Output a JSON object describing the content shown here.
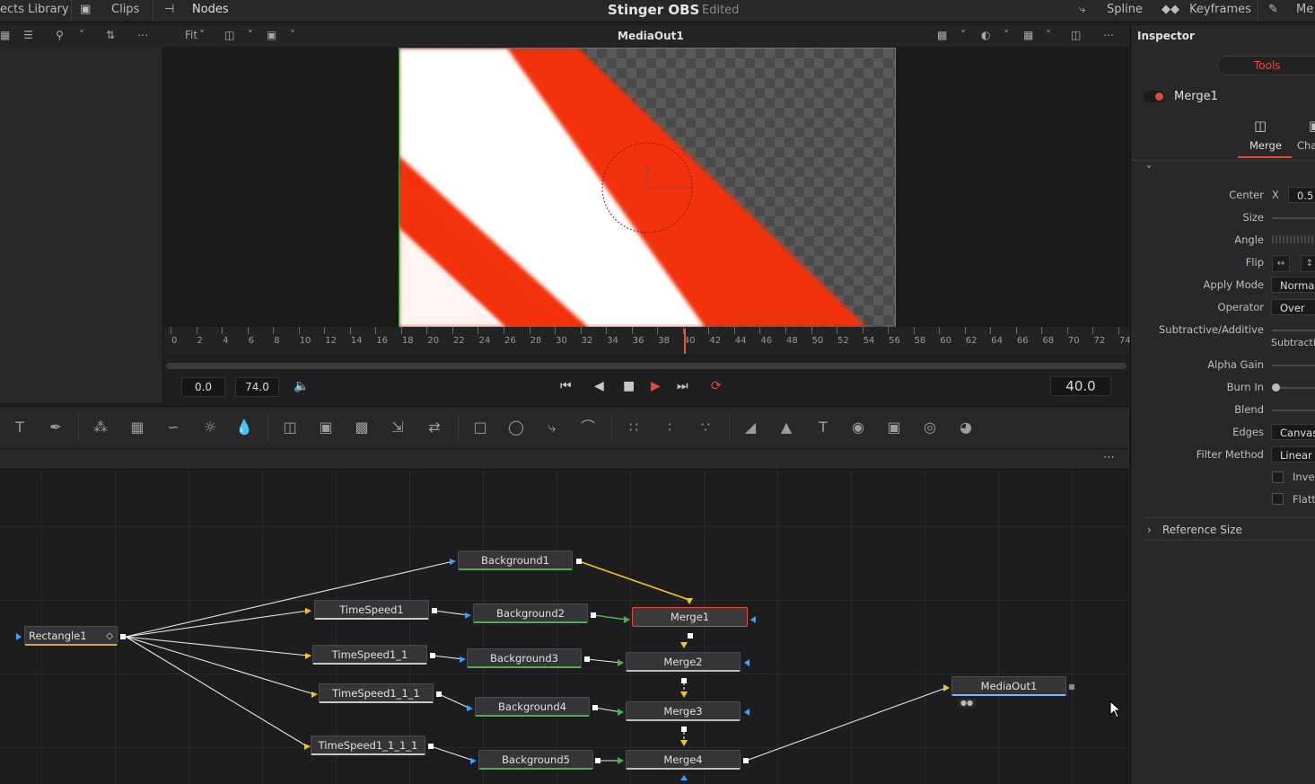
{
  "topbar": {
    "effects_library": "ects Library",
    "clips": "Clips",
    "nodes": "Nodes",
    "title": "Stinger OBS",
    "status": "Edited",
    "spline": "Spline",
    "keyframes": "Keyframes",
    "metadata": "Me"
  },
  "viewer": {
    "zoom": "Fit",
    "title": "MediaOut1"
  },
  "ruler": {
    "ticks": [
      "0",
      "2",
      "4",
      "6",
      "8",
      "10",
      "12",
      "14",
      "16",
      "18",
      "20",
      "22",
      "24",
      "26",
      "28",
      "30",
      "32",
      "34",
      "36",
      "38",
      "40",
      "42",
      "44",
      "46",
      "48",
      "50",
      "52",
      "54",
      "56",
      "58",
      "60",
      "62",
      "64",
      "66",
      "68",
      "70",
      "72",
      "74"
    ]
  },
  "transport": {
    "start": "0.0",
    "end": "74.0",
    "current": "40.0"
  },
  "nodes": [
    {
      "id": "rect",
      "label": "Rectangle1"
    },
    {
      "id": "bg1",
      "label": "Background1"
    },
    {
      "id": "ts1",
      "label": "TimeSpeed1"
    },
    {
      "id": "bg2",
      "label": "Background2"
    },
    {
      "id": "m1",
      "label": "Merge1"
    },
    {
      "id": "ts2",
      "label": "TimeSpeed1_1"
    },
    {
      "id": "bg3",
      "label": "Background3"
    },
    {
      "id": "m2",
      "label": "Merge2"
    },
    {
      "id": "ts3",
      "label": "TimeSpeed1_1_1"
    },
    {
      "id": "bg4",
      "label": "Background4"
    },
    {
      "id": "m3",
      "label": "Merge3"
    },
    {
      "id": "ts4",
      "label": "TimeSpeed1_1_1_1"
    },
    {
      "id": "bg5",
      "label": "Background5"
    },
    {
      "id": "m4",
      "label": "Merge4"
    },
    {
      "id": "out",
      "label": "MediaOut1"
    }
  ],
  "inspector": {
    "title": "Inspector",
    "tools_tab": "Tools",
    "node_name": "Merge1",
    "merge_tab": "Merge",
    "channels_tab": "Cha",
    "center_label": "Center",
    "center_x_label": "X",
    "center_x_value": "0.5",
    "size_label": "Size",
    "angle_label": "Angle",
    "flip_label": "Flip",
    "apply_mode_label": "Apply Mode",
    "apply_mode_value": "Normal",
    "operator_label": "Operator",
    "operator_value": "Over",
    "sub_add_label": "Subtractive/Additive",
    "sub_add_value": "Subtractiv",
    "alpha_gain_label": "Alpha Gain",
    "burn_in_label": "Burn In",
    "blend_label": "Blend",
    "edges_label": "Edges",
    "edges_value": "Canvas",
    "filter_label": "Filter Method",
    "filter_value": "Linear",
    "invert_label": "Inver",
    "flatten_label": "Flatte",
    "reference_size": "Reference Size"
  },
  "colors": {
    "accent_red": "#e24a3a",
    "viewer_red": "#f3300f",
    "node_green": "#4caf50",
    "link_yellow": "#f5c518"
  }
}
